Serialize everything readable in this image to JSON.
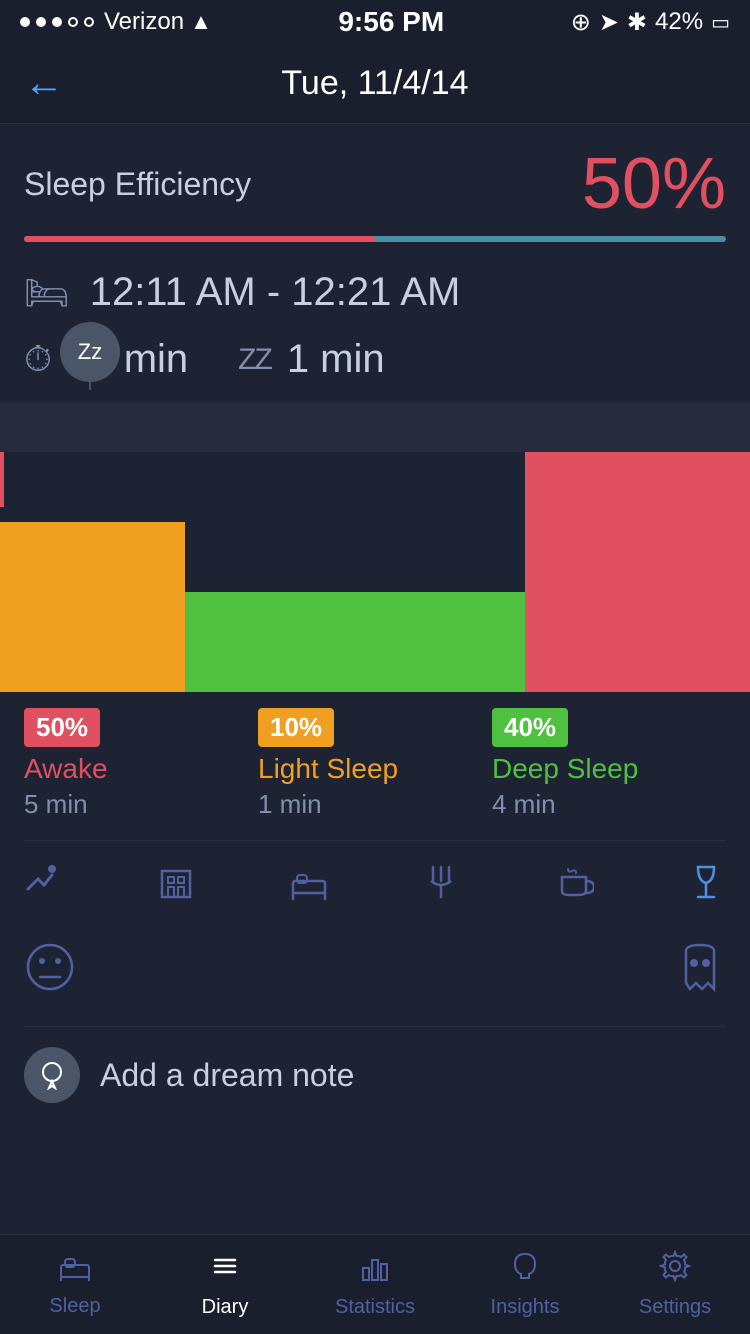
{
  "statusBar": {
    "carrier": "Verizon",
    "time": "9:56 PM",
    "battery": "42%"
  },
  "header": {
    "backLabel": "←",
    "title": "Tue, 11/4/14"
  },
  "sleepEfficiency": {
    "label": "Sleep Efficiency",
    "value": "50%",
    "progressFill": 50
  },
  "sleepTime": {
    "range": "12:11 AM - 12:21 AM"
  },
  "stats": {
    "duration": "10 min",
    "sleepTime": "1 min"
  },
  "legend": {
    "awake": {
      "percent": "50%",
      "label": "Awake",
      "time": "5 min"
    },
    "lightSleep": {
      "percent": "10%",
      "label": "Light Sleep",
      "time": "1 min"
    },
    "deepSleep": {
      "percent": "40%",
      "label": "Deep Sleep",
      "time": "4 min"
    }
  },
  "dreamNote": {
    "text": "Add a dream note"
  },
  "tabs": {
    "sleep": "Sleep",
    "diary": "Diary",
    "statistics": "Statistics",
    "insights": "Insights",
    "settings": "Settings"
  }
}
